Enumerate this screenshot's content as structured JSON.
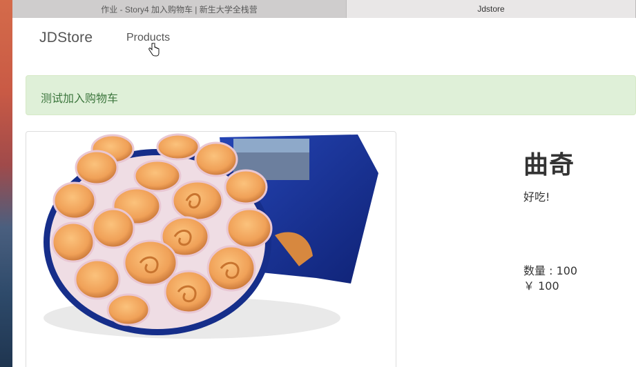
{
  "browser": {
    "tabs": [
      {
        "title": "作业 - Story4 加入购物车 | 新生大学全栈营",
        "active": false
      },
      {
        "title": "Jdstore",
        "active": true
      }
    ]
  },
  "navbar": {
    "brand": "JDStore",
    "links": [
      {
        "label": "Products"
      }
    ]
  },
  "flash": {
    "message": "测试加入购物车",
    "type": "success"
  },
  "product": {
    "image_alt": "cookie-tin-photo",
    "title": "曲奇",
    "description": "好吃!",
    "quantity_text": "数量 : 100",
    "price_text": "￥ 100"
  },
  "colors": {
    "alert_bg": "#dff0d8",
    "alert_text": "#3c763d",
    "tin_blue": "#1d3a9c",
    "cookie": "#f0a65a"
  }
}
